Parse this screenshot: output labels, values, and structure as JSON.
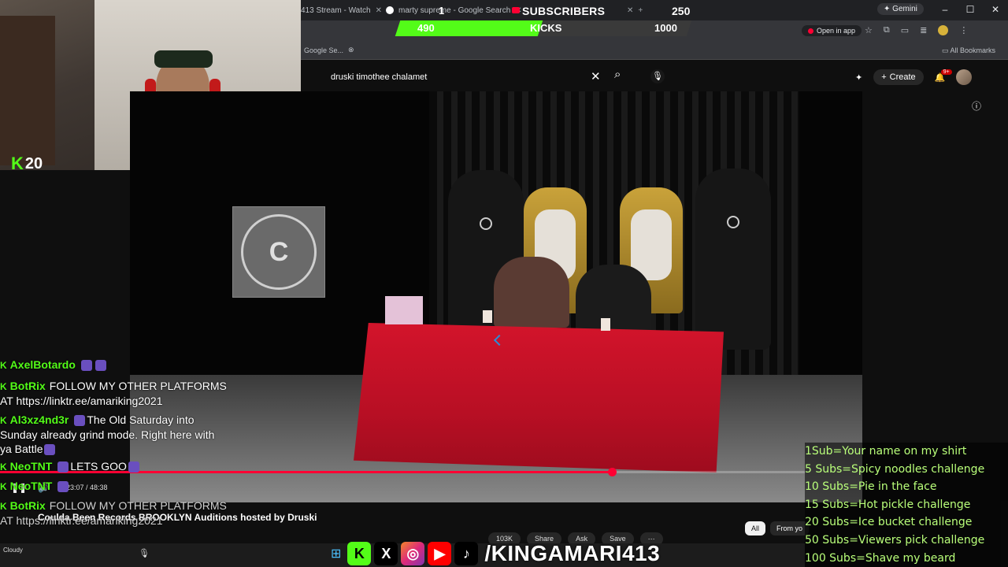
{
  "browser": {
    "tabs": [
      {
        "label": "413 Stream - Watch"
      },
      {
        "label": "marty supreme - Google Search"
      }
    ],
    "gemini_label": "Gemini",
    "bookmark_left": "Google Se...",
    "open_in_app": "Open in app",
    "all_bookmarks": "All Bookmarks",
    "tab_counter": "1"
  },
  "subs_goal": {
    "label": "SUBSCRIBERS",
    "current": "",
    "goal": "250"
  },
  "kicks_goal": {
    "label": "KICKS",
    "current": "490",
    "goal": "1000",
    "progress_fraction": 0.49
  },
  "webcam": {
    "kick_count": "20"
  },
  "youtube": {
    "search_value": "druski timothee chalamet",
    "create_label": "Create",
    "notif_badge": "9+",
    "video_title": "Coulda Been Records BROOKLYN Auditions hosted by Druski",
    "time_readout": "23:07 / 48:38",
    "progress_fraction": 0.76,
    "actions": [
      "103K",
      "Share",
      "Ask",
      "Save"
    ],
    "filter_chips": [
      "All",
      "From yo"
    ],
    "sign_letter": "C"
  },
  "chat": [
    {
      "user": "AxelBotardo",
      "text": ""
    },
    {
      "user": "BotRix",
      "text": "FOLLOW MY OTHER PLATFORMS AT https://linktr.ee/amariking2021"
    },
    {
      "user": "Al3xz4nd3r",
      "text": "The Old Saturday into Sunday already grind mode. Right here with ya Battle"
    },
    {
      "user": "NeoTNT",
      "text": "LETS GOO"
    },
    {
      "user": "NeoTNT",
      "text": ""
    },
    {
      "user": "BotRix",
      "text": "FOLLOW MY OTHER PLATFORMS AT https://linktr.ee/amariking2021"
    }
  ],
  "goals": [
    "1Sub=Your name on my shirt",
    "5 Subs=Spicy noodles challenge",
    "10 Subs=Pie in the face",
    "15 Subs=Hot pickle challenge",
    "20 Subs=Ice bucket challenge",
    "50 Subs=Viewers pick challenge",
    "100 Subs=Shave my beard"
  ],
  "taskbar": {
    "weather": "Cloudy"
  },
  "socials": {
    "handle": "/KINGAMARI413"
  },
  "colors": {
    "kick_green": "#53fc18",
    "goal_text": "#b9ff7a",
    "youtube_red": "#ff0033",
    "table_red": "#d3142b"
  }
}
